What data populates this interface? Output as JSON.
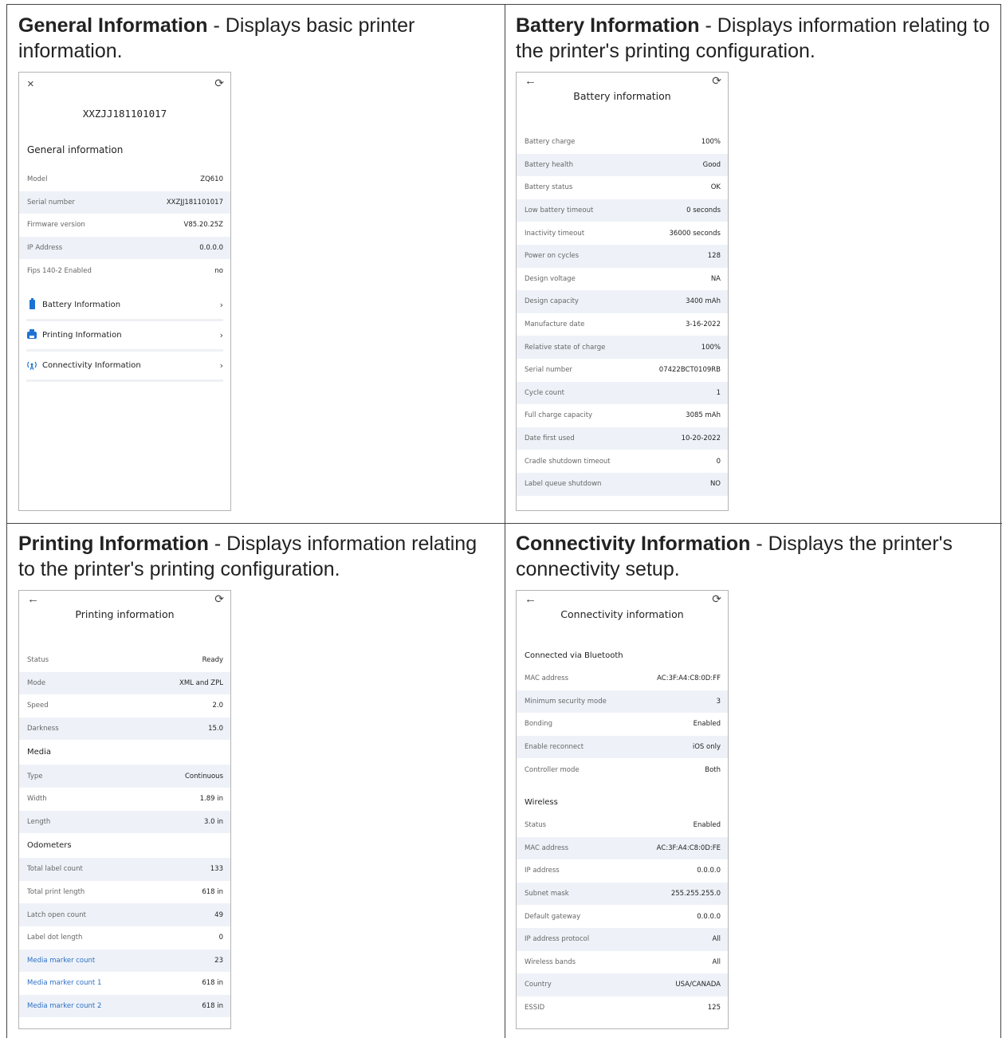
{
  "general": {
    "caption_bold": "General Information",
    "caption_rest": " - Displays basic printer information.",
    "close_icon": "×",
    "refresh_icon": "⟳",
    "device_name": "XXZJJ181101017",
    "section_title": "General information",
    "rows": [
      {
        "key": "Model",
        "value": "ZQ610"
      },
      {
        "key": "Serial number",
        "value": "XXZJJ181101017"
      },
      {
        "key": "Firmware version",
        "value": "V85.20.25Z"
      },
      {
        "key": "IP Address",
        "value": "0.0.0.0"
      },
      {
        "key": "Fips 140-2 Enabled",
        "value": "no"
      }
    ],
    "nav": [
      {
        "label": "Battery Information",
        "icon": "battery-icon"
      },
      {
        "label": "Printing Information",
        "icon": "printer-icon"
      },
      {
        "label": "Connectivity Information",
        "icon": "wireless-icon"
      }
    ],
    "chevron": "›"
  },
  "battery": {
    "caption_bold": "Battery Information",
    "caption_rest": " - Displays information relating to the printer's printing configuration.",
    "back_icon": "←",
    "refresh_icon": "⟳",
    "title": "Battery information",
    "rows": [
      {
        "key": "Battery charge",
        "value": "100%"
      },
      {
        "key": "Battery health",
        "value": "Good"
      },
      {
        "key": "Battery status",
        "value": "OK"
      },
      {
        "key": "Low battery timeout",
        "value": "0 seconds"
      },
      {
        "key": "Inactivity timeout",
        "value": "36000 seconds"
      },
      {
        "key": "Power on cycles",
        "value": "128"
      },
      {
        "key": "Design voltage",
        "value": "NA"
      },
      {
        "key": "Design capacity",
        "value": "3400 mAh"
      },
      {
        "key": "Manufacture date",
        "value": "3-16-2022"
      },
      {
        "key": "Relative state of charge",
        "value": "100%"
      },
      {
        "key": "Serial number",
        "value": "07422BCT0109RB"
      },
      {
        "key": "Cycle count",
        "value": "1"
      },
      {
        "key": "Full charge capacity",
        "value": "3085 mAh"
      },
      {
        "key": "Date first used",
        "value": "10-20-2022"
      },
      {
        "key": "Cradle shutdown timeout",
        "value": "0"
      },
      {
        "key": "Label queue shutdown",
        "value": "NO"
      }
    ]
  },
  "printing": {
    "caption_bold": "Printing Information",
    "caption_rest": " - Displays information relating to the printer's printing configuration.",
    "back_icon": "←",
    "refresh_icon": "⟳",
    "title": "Printing information",
    "rows": [
      {
        "key": "Status",
        "value": "Ready"
      },
      {
        "key": "Mode",
        "value": "XML and ZPL"
      },
      {
        "key": "Speed",
        "value": "2.0"
      },
      {
        "key": "Darkness",
        "value": "15.0"
      }
    ],
    "media_title": "Media",
    "media_rows": [
      {
        "key": "Type",
        "value": "Continuous"
      },
      {
        "key": "Width",
        "value": "1.89 in"
      },
      {
        "key": "Length",
        "value": "3.0 in"
      }
    ],
    "odometers_title": "Odometers",
    "odometer_rows": [
      {
        "key": "Total label count",
        "value": "133"
      },
      {
        "key": "Total print length",
        "value": "618 in"
      },
      {
        "key": "Latch open count",
        "value": "49"
      },
      {
        "key": "Label dot length",
        "value": "0"
      },
      {
        "key": "Media marker count",
        "value": "23"
      },
      {
        "key": "Media marker count 1",
        "value": "618 in"
      },
      {
        "key": "Media marker count 2",
        "value": "618 in"
      }
    ]
  },
  "connectivity": {
    "caption_bold": "Connectivity Information",
    "caption_rest": " - Displays the printer's connectivity setup.",
    "back_icon": "←",
    "refresh_icon": "⟳",
    "title": "Connectivity information",
    "bt_title": "Connected via Bluetooth",
    "bt_rows": [
      {
        "key": "MAC address",
        "value": "AC:3F:A4:C8:0D:FF"
      },
      {
        "key": "Minimum security mode",
        "value": "3"
      },
      {
        "key": "Bonding",
        "value": "Enabled"
      },
      {
        "key": "Enable reconnect",
        "value": "iOS only"
      },
      {
        "key": "Controller mode",
        "value": "Both"
      }
    ],
    "wireless_title": "Wireless",
    "wireless_rows": [
      {
        "key": "Status",
        "value": "Enabled"
      },
      {
        "key": "MAC address",
        "value": "AC:3F:A4:C8:0D:FE"
      },
      {
        "key": "IP address",
        "value": "0.0.0.0"
      },
      {
        "key": "Subnet mask",
        "value": "255.255.255.0"
      },
      {
        "key": "Default gateway",
        "value": "0.0.0.0"
      },
      {
        "key": "IP address protocol",
        "value": "All"
      },
      {
        "key": "Wireless bands",
        "value": "All"
      },
      {
        "key": "Country",
        "value": "USA/CANADA"
      },
      {
        "key": "ESSID",
        "value": "125"
      }
    ]
  }
}
